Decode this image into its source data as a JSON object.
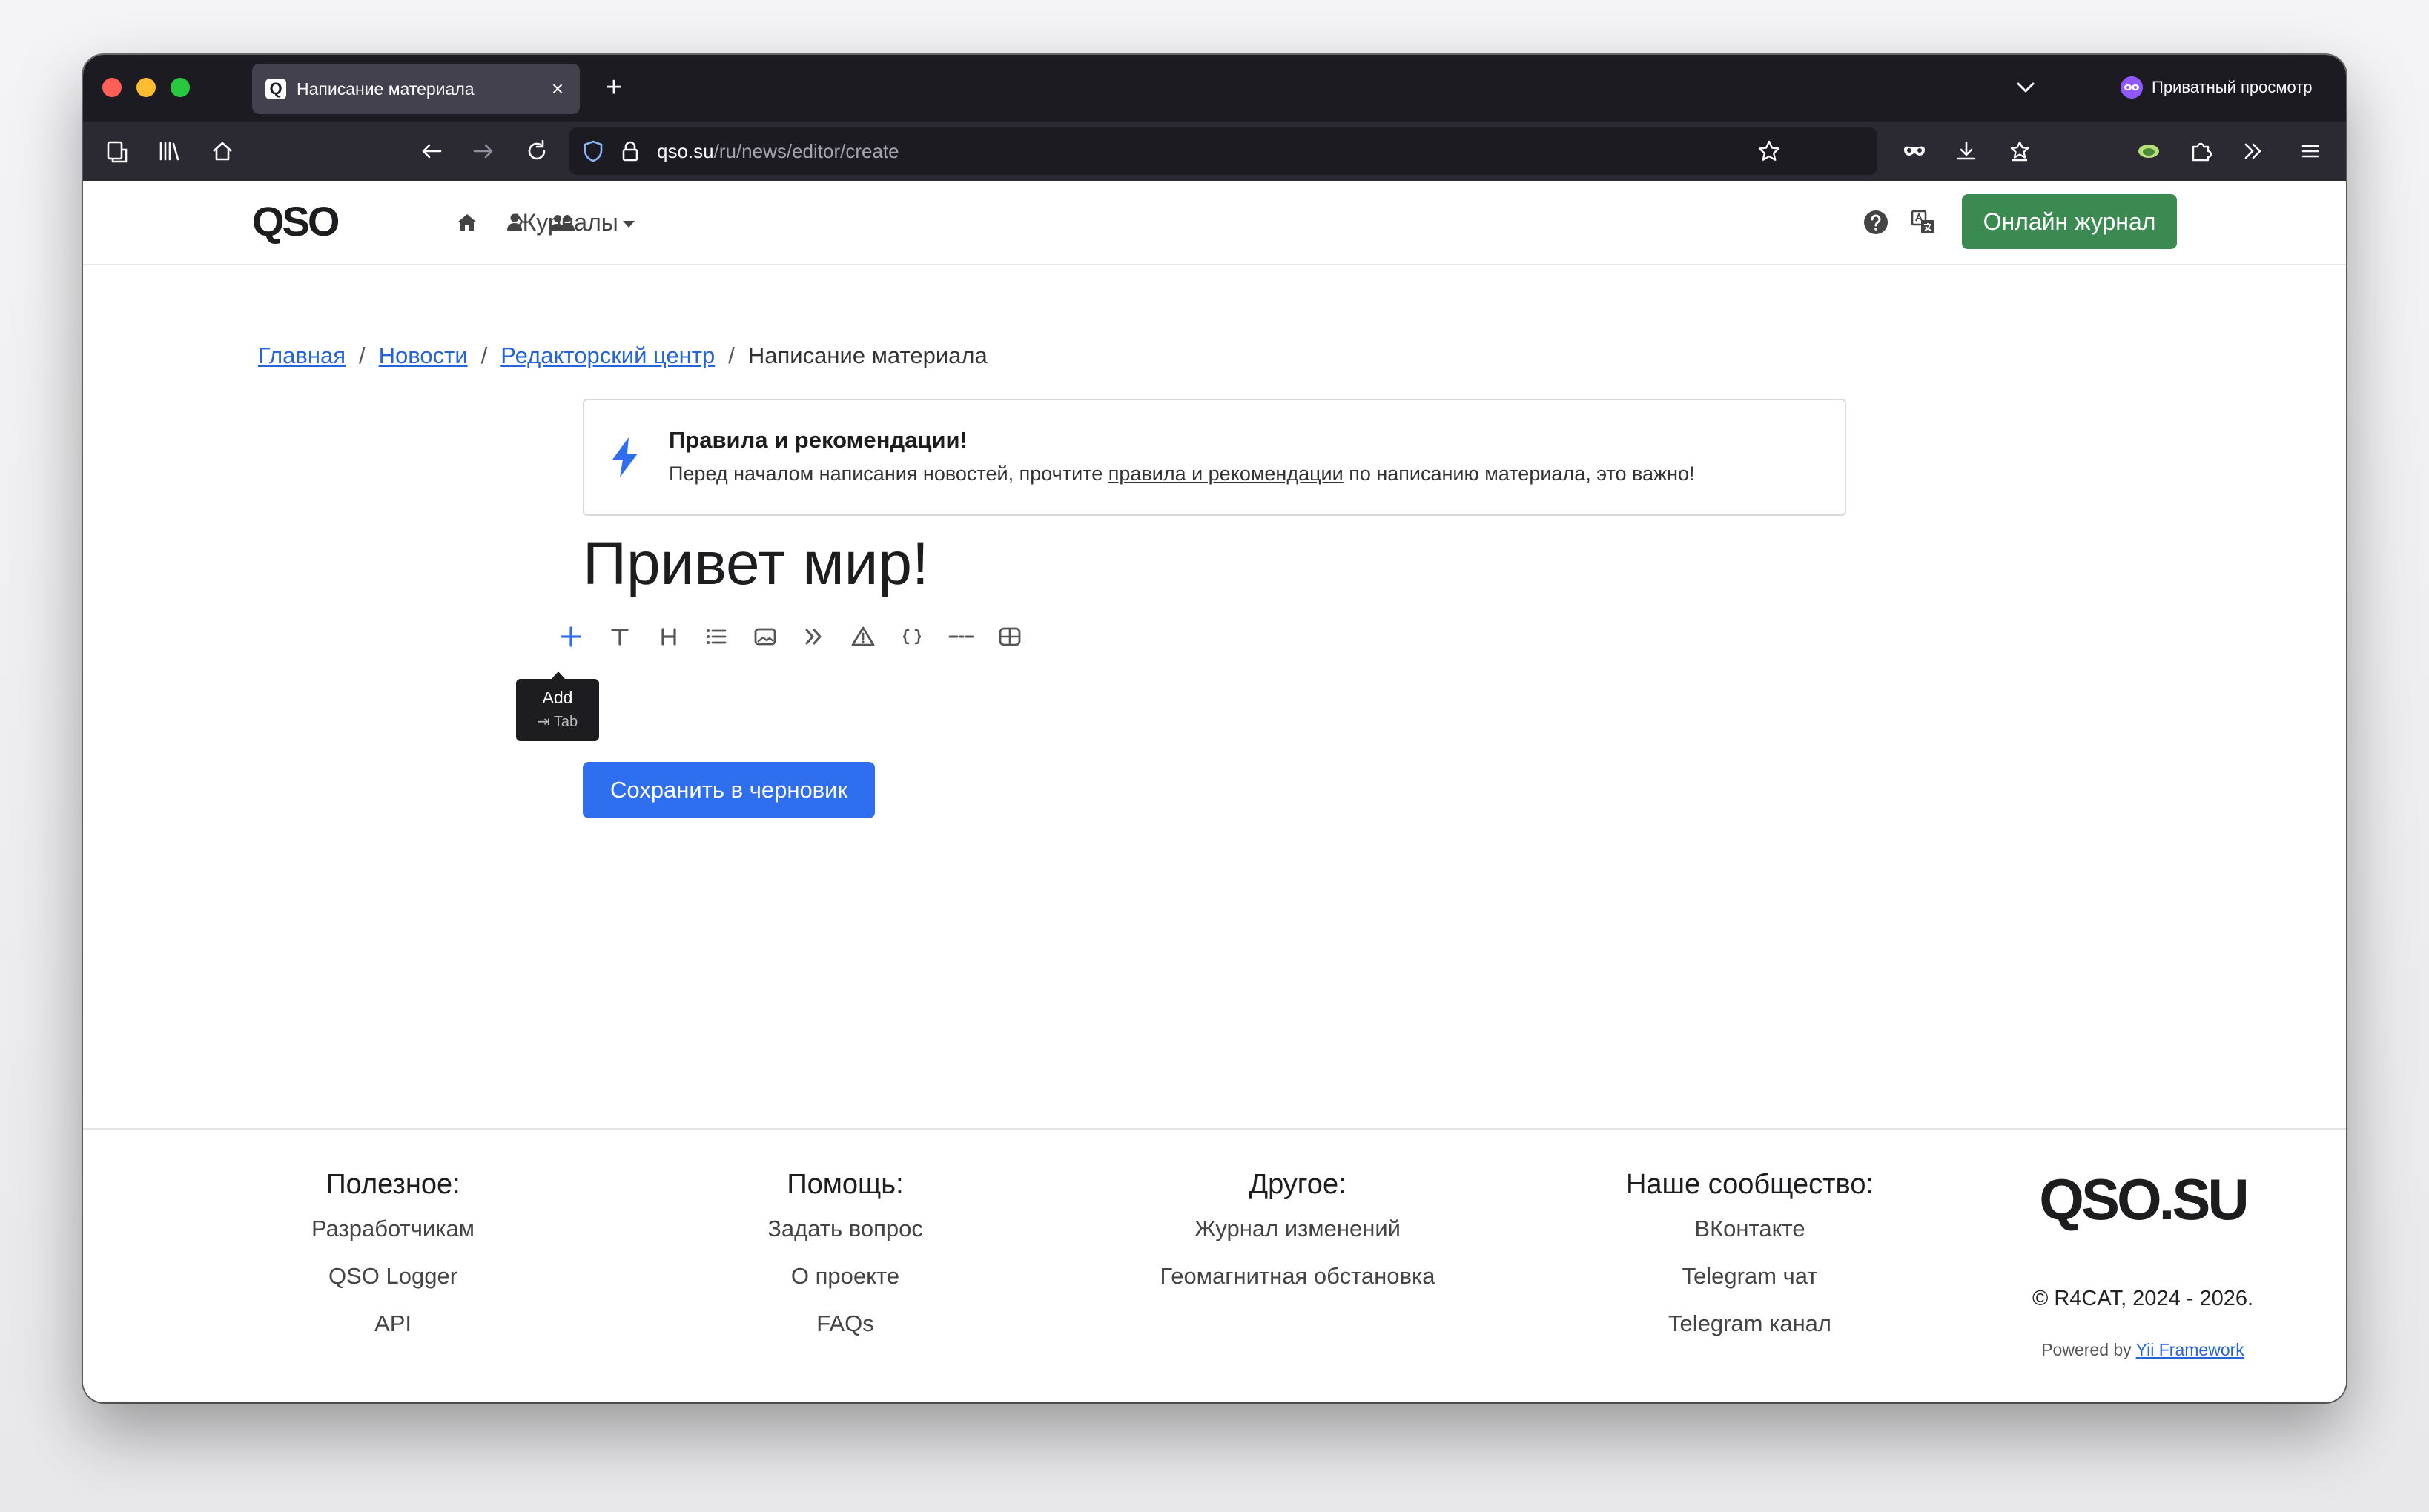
{
  "browser": {
    "tab_title": "Написание материала",
    "tab_favicon": "Q",
    "private_label": "Приватный просмотр",
    "url_host": "qso.su",
    "url_path": "/ru/news/editor/create"
  },
  "header": {
    "logo": "QSO",
    "journals_label": "Журналы",
    "online_button": "Онлайн журнал"
  },
  "breadcrumb": {
    "home": "Главная",
    "news": "Новости",
    "editor_center": "Редакторский центр",
    "current": "Написание материала",
    "separator": "/"
  },
  "rules": {
    "title": "Правила и рекомендации!",
    "text_before": "Перед началом написания новостей, прочтите ",
    "link": "правила и рекомендации",
    "text_after": " по написанию материала, это важно!"
  },
  "editor": {
    "title": "Привет мир!",
    "toolbar_icons": [
      "plus-icon",
      "text-icon",
      "heading-icon",
      "list-icon",
      "image-icon",
      "quote-icon",
      "warning-icon",
      "code-icon",
      "delimiter-icon",
      "table-icon"
    ],
    "tooltip_title": "Add",
    "tooltip_shortcut": "⇥ Tab",
    "save_button": "Сохранить в черновик"
  },
  "footer": {
    "columns": [
      {
        "title": "Полезное:",
        "links": [
          "Разработчикам",
          "QSO Logger",
          "API"
        ]
      },
      {
        "title": "Помощь:",
        "links": [
          "Задать вопрос",
          "О проекте",
          "FAQs"
        ]
      },
      {
        "title": "Другое:",
        "links": [
          "Журнал изменений",
          "Геомагнитная обстановка"
        ]
      },
      {
        "title": "Наше сообщество:",
        "links": [
          "ВКонтакте",
          "Telegram чат",
          "Telegram канал"
        ]
      }
    ],
    "logo": "QSO.SU",
    "copyright": "© R4CAT, 2024 - 2026.",
    "powered_prefix": "Powered by ",
    "powered_link": "Yii Framework"
  },
  "colors": {
    "accent_green": "#3a8a52",
    "accent_blue": "#2f6fef",
    "link_blue": "#2563d8",
    "chrome_dark": "#1c1b22"
  }
}
